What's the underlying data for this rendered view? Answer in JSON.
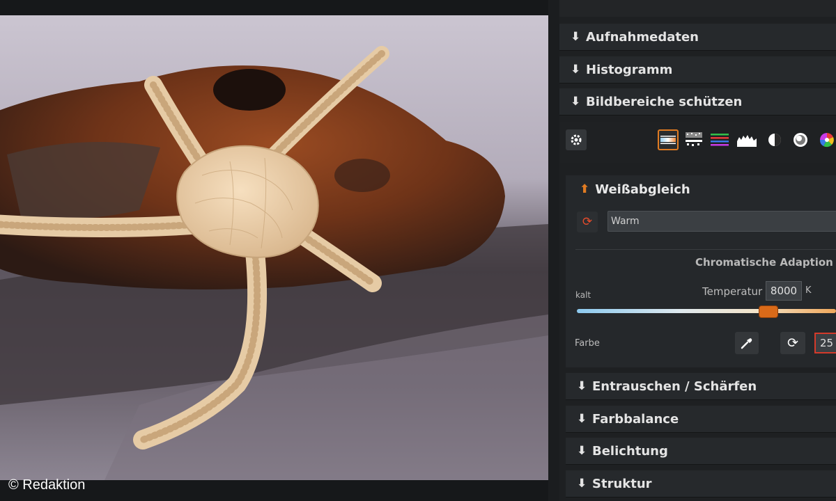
{
  "photo": {
    "copyright": "© Redaktion"
  },
  "panel": {
    "sections_top": [
      {
        "label": "Aufnahmedaten"
      },
      {
        "label": "Histogramm"
      },
      {
        "label": "Bildbereiche schützen"
      }
    ],
    "toolbar": {
      "icons": [
        "gear-icon",
        "white-balance-tool-icon",
        "noise-tool-icon",
        "color-lines-tool-icon",
        "histogram-tool-icon",
        "contrast-tool-icon",
        "vignette-tool-icon",
        "color-wheel-tool-icon"
      ],
      "active_color": "#e07b22"
    },
    "white_balance": {
      "title": "Weißabgleich",
      "preset_value": "Warm",
      "chromatic_label": "Chromatische Adaption",
      "kalt_label": "kalt",
      "temperature_label": "Temperatur",
      "temperature_value": "8000",
      "temperature_unit": "K",
      "temperature_fraction": 0.74,
      "farbe_label": "Farbe",
      "farbe_value": "25"
    },
    "sections_bottom": [
      {
        "label": "Entrauschen / Schärfen"
      },
      {
        "label": "Farbbalance"
      },
      {
        "label": "Belichtung"
      },
      {
        "label": "Struktur"
      }
    ]
  }
}
